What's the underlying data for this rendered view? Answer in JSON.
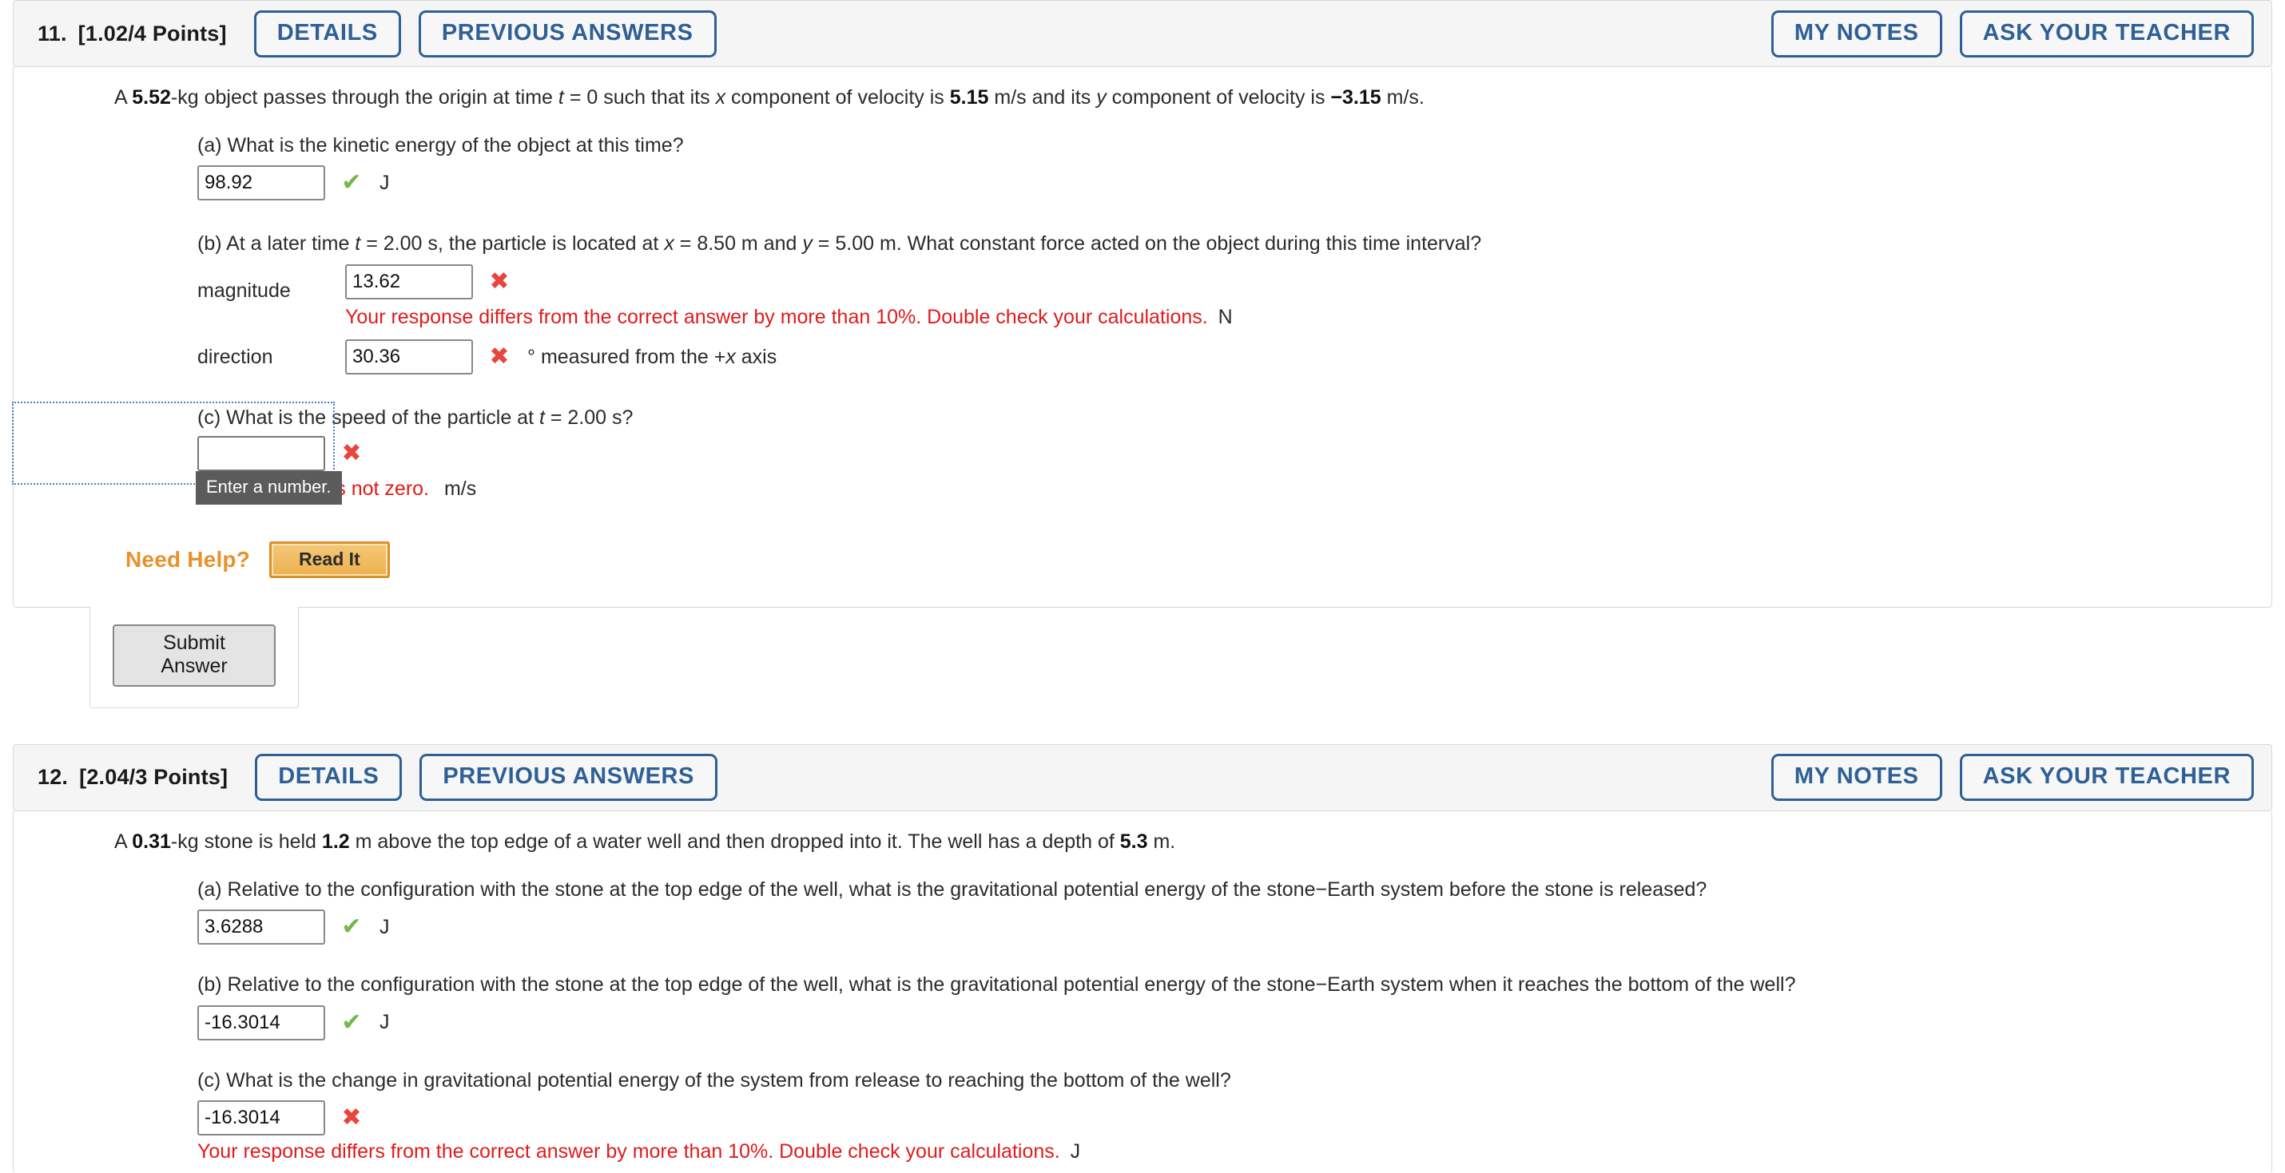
{
  "problems": [
    {
      "number": "11.",
      "points": "[1.02/4 Points]",
      "buttons": {
        "details": "DETAILS",
        "previous_answers": "PREVIOUS ANSWERS",
        "my_notes": "MY NOTES",
        "ask_your_teacher": "ASK YOUR TEACHER"
      },
      "statement": {
        "t1": "A ",
        "mass": "5.52",
        "t2": "-kg object passes through the origin at time ",
        "var_t": "t",
        "t3": " = 0 such that its ",
        "var_x": "x",
        "t4": " component of velocity is ",
        "vx": "5.15",
        "t5": " m/s and its ",
        "var_y": "y",
        "t6": " component of velocity is ",
        "vy": "−3.15",
        "t7": " m/s."
      },
      "parts": [
        {
          "label": "(a) What is the kinetic energy of the object at this time?",
          "value": "98.92",
          "status": "correct",
          "unit": "J"
        },
        {
          "label_a": "(b) At a later time ",
          "label_it1": "t",
          "label_b": " = 2.00 s, the particle is located at ",
          "label_it2": "x",
          "label_c": " = 8.50 m and ",
          "label_it3": "y",
          "label_d": " = 5.00 m. What constant force acted on the object during this time interval?",
          "rows": [
            {
              "row_label": "magnitude",
              "value": "13.62",
              "status": "incorrect",
              "error": "Your response differs from the correct answer by more than 10%. Double check your calculations.",
              "unit": "N"
            },
            {
              "row_label": "direction",
              "value": "30.36",
              "status": "incorrect",
              "unit_pre": "° measured from the +",
              "unit_it": "x",
              "unit_post": " axis"
            }
          ]
        },
        {
          "label_a": "(c) What is the speed of the particle at ",
          "label_it1": "t",
          "label_b": " = 2.00 s?",
          "value": "",
          "status": "incorrect",
          "error_visible": "swer is not zero.",
          "unit": "m/s",
          "tooltip": "Enter a number."
        }
      ],
      "need_help": {
        "label": "Need Help?",
        "read_it": "Read It"
      },
      "submit": "Submit Answer"
    },
    {
      "number": "12.",
      "points": "[2.04/3 Points]",
      "buttons": {
        "details": "DETAILS",
        "previous_answers": "PREVIOUS ANSWERS",
        "my_notes": "MY NOTES",
        "ask_your_teacher": "ASK YOUR TEACHER"
      },
      "statement": {
        "t1": "A ",
        "mass": "0.31",
        "t2": "-kg stone is held ",
        "height": "1.2",
        "t3": " m above the top edge of a water well and then dropped into it. The well has a depth of ",
        "depth": "5.3",
        "t4": " m."
      },
      "parts": [
        {
          "label": "(a) Relative to the configuration with the stone at the top edge of the well, what is the gravitational potential energy of the stone−Earth system before the stone is released?",
          "value": "3.6288",
          "status": "correct",
          "unit": "J"
        },
        {
          "label": "(b) Relative to the configuration with the stone at the top edge of the well, what is the gravitational potential energy of the stone−Earth system when it reaches the bottom of the well?",
          "value": "-16.3014",
          "status": "correct",
          "unit": "J"
        },
        {
          "label": "(c) What is the change in gravitational potential energy of the system from release to reaching the bottom of the well?",
          "value": "-16.3014",
          "status": "incorrect",
          "error": "Your response differs from the correct answer by more than 10%. Double check your calculations.",
          "unit": "J"
        }
      ]
    }
  ],
  "icons": {
    "check": "✔",
    "cross": "✖"
  }
}
